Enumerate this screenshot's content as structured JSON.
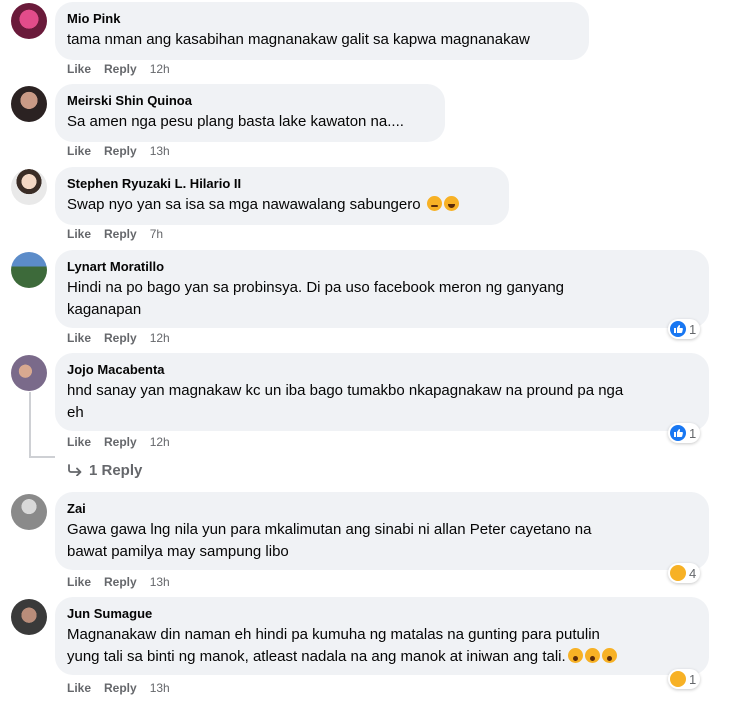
{
  "actions": {
    "like": "Like",
    "reply": "Reply"
  },
  "comments": [
    {
      "author": "Mio Pink",
      "text": "tama nman ang kasabihan magnanakaw galit sa kapwa magnanakaw",
      "time": "12h"
    },
    {
      "author": "Meirski Shin Quinoa",
      "text": "Sa amen nga pesu plang basta lake kawaton na....",
      "time": "13h"
    },
    {
      "author": "Stephen Ryuzaki L. Hilario II",
      "text": "Swap nyo yan sa isa sa mga nawawalang sabungero",
      "time": "7h",
      "emojis": [
        "sad-face-emoji",
        "laughing-face-emoji"
      ]
    },
    {
      "author": "Lynart Moratillo",
      "text_lines": [
        "Hindi na po bago yan sa probinsya. Di pa uso facebook meron ng ganyang",
        "kaganapan"
      ],
      "time": "12h",
      "reaction": {
        "icon": "like-icon",
        "count": "1"
      }
    },
    {
      "author": "Jojo Macabenta",
      "text_lines": [
        "hnd sanay yan magnakaw kc un iba bago tumakbo nkapagnakaw na pround pa nga",
        "eh"
      ],
      "time": "12h",
      "reaction": {
        "icon": "like-icon",
        "count": "1"
      },
      "replies_label": "1 Reply"
    },
    {
      "author": "Zai",
      "text_lines": [
        "Gawa gawa lng nila yun para mkalimutan ang sinabi ni allan Peter cayetano na",
        "bawat pamilya may sampung libo"
      ],
      "time": "13h",
      "reaction": {
        "icon": "haha-icon",
        "count": "4"
      }
    },
    {
      "author": "Jun Sumague",
      "text_lines": [
        "Magnanakaw din naman eh hindi pa kumuha ng matalas na gunting para putulin",
        "yung tali sa binti ng manok, atleast nadala na ang manok at iniwan ang tali."
      ],
      "time": "13h",
      "emojis": [
        "wow-face-emoji",
        "wow-face-emoji",
        "wow-face-emoji"
      ],
      "reaction": {
        "icon": "haha-icon",
        "count": "1"
      }
    }
  ],
  "colors": {
    "bubble": "#f0f2f5",
    "secondary_text": "#65676b",
    "like_blue": "#1877f2",
    "haha_yellow": "#f7b125"
  }
}
